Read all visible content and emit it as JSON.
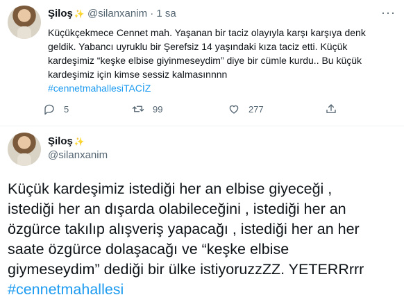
{
  "tweet": {
    "author_name": "Şiloş",
    "handle": "@silanxanim",
    "separator": "·",
    "time": "1 sa",
    "more_menu": "···",
    "text_lines": [
      "Küçükçekmece Cennet mah. Yaşanan bir taciz olayıyla karşı karşıya denk",
      "geldik. Yabancı uyruklu bir Şerefsiz 14 yaşındaki kıza taciz etti. Küçük",
      "kardeşimiz “keşke elbise giyinmeseydim” diye bir cümle kurdu.. Bu küçük",
      "kardeşimiz için kimse sessiz kalmasınnnn"
    ],
    "hashtag": "#cennetmahallesiTACİZ",
    "actions": {
      "reply_count": "5",
      "retweet_count": "99",
      "like_count": "277"
    }
  },
  "quoted_tweet": {
    "author_name": "Şiloş",
    "handle": "@silanxanim",
    "text_lines": [
      "Küçük kardeşimiz istediği her an elbise giyeceği ,",
      "istediği her an dışarda olabileceğini , istediği her an",
      "özgürce takılıp alışveriş yapacağı , istediği her an her",
      "saate özgürce dolaşacağı ve “keşke elbise",
      "giymeseydim” dediği bir ülke istiyoruzzZZ. YETERRrrr"
    ],
    "hashtag": "#cennetmahallesi"
  },
  "colors": {
    "text": "#0f1419",
    "muted": "#536471",
    "link": "#1d9bf0",
    "divider": "#eff3f4"
  },
  "icons": [
    "avatar",
    "sparkle-emoji",
    "more-icon",
    "reply-icon",
    "retweet-icon",
    "like-icon",
    "share-icon"
  ]
}
